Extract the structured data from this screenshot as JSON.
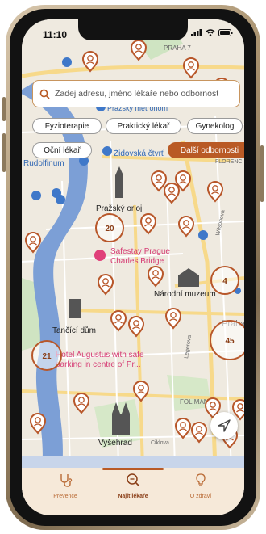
{
  "status": {
    "time": "11:10"
  },
  "search": {
    "placeholder": "Zadej adresu, jméno lékaře nebo odbornost"
  },
  "chips": [
    "Fyzioterapie",
    "Praktický lékař",
    "Gynekolog",
    "Oční lékař",
    "Další odbornosti"
  ],
  "map": {
    "labels": {
      "praha7": "PRAHA 7",
      "metronom": "Pražský metronom",
      "rudolfinum": "Rudolfinum",
      "zidovska": "Židovská čtvrť",
      "florenc": "FLORENC",
      "orloj": "Pražský orloj",
      "wilsonova": "Wilsonova",
      "safestay1": "Safestay Prague",
      "safestay2": "Charles Bridge",
      "muzeum": "Národní muzeum",
      "tancici": "Tančící dům",
      "augustus1": "Hotel Augustus with safe",
      "augustus2": "parking in centre of Pr...",
      "legerova": "Legerova",
      "praha2": "Praha",
      "folimanka": "FOLIMANKA",
      "vysehrad": "Vyšehrad",
      "ciklova": "Ciklova"
    },
    "clusters": [
      "20",
      "4",
      "45",
      "21"
    ]
  },
  "tabs": [
    {
      "label": "Prevence",
      "icon": "stethoscope-icon"
    },
    {
      "label": "Najít lékaře",
      "icon": "search-doctor-icon"
    },
    {
      "label": "O zdraví",
      "icon": "lightbulb-icon"
    }
  ],
  "colors": {
    "accent": "#b95a25",
    "pin": "#b8572a",
    "water": "#7c9fd6",
    "tabbar": "#f6e9d9"
  }
}
